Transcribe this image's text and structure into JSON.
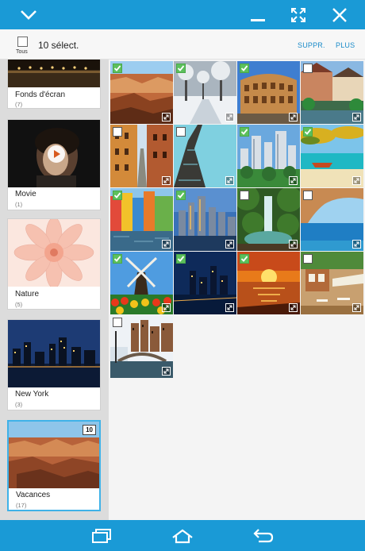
{
  "header": {
    "collapse_icon": "chevron-down-icon",
    "minimize_icon": "minimize-icon",
    "expand_icon": "expand-arrows-icon",
    "close_icon": "close-icon",
    "bar_color": "#1a9ad6"
  },
  "actionbar": {
    "select_all_label": "Tous",
    "selected_count": "10 sélect.",
    "delete_label": "SUPPR.",
    "more_label": "PLUS",
    "accent_color": "#1a8bc9"
  },
  "albums": [
    {
      "name": "Fonds d'écran",
      "count": "(7)"
    },
    {
      "name": "Movie",
      "count": "(1)"
    },
    {
      "name": "Nature",
      "count": "(5)"
    },
    {
      "name": "New York",
      "count": "(3)"
    },
    {
      "name": "Vacances",
      "count": "(17)",
      "badge": "10",
      "selected": true
    }
  ],
  "photos": [
    {
      "theme": "canyon",
      "checked": true
    },
    {
      "theme": "snow-park",
      "checked": true
    },
    {
      "theme": "colosseum",
      "checked": true
    },
    {
      "theme": "canal-town",
      "checked": false
    },
    {
      "theme": "old-street",
      "checked": false
    },
    {
      "theme": "eiffel-tower",
      "checked": false
    },
    {
      "theme": "city-skyline",
      "checked": true
    },
    {
      "theme": "tropical-beach",
      "checked": true
    },
    {
      "theme": "colorful-houses",
      "checked": true
    },
    {
      "theme": "manhattan",
      "checked": true
    },
    {
      "theme": "waterfall",
      "checked": false
    },
    {
      "theme": "sea-arch",
      "checked": false
    },
    {
      "theme": "windmill-tulips",
      "checked": true
    },
    {
      "theme": "night-harbor",
      "checked": true
    },
    {
      "theme": "sunset-sea",
      "checked": true
    },
    {
      "theme": "terrace-cafe",
      "checked": false
    },
    {
      "theme": "amsterdam-bridge",
      "checked": false
    }
  ],
  "navbar": {
    "recent_icon": "recent-apps-icon",
    "home_icon": "home-icon",
    "back_icon": "back-arrow-icon",
    "bar_color": "#1a9ad6"
  }
}
